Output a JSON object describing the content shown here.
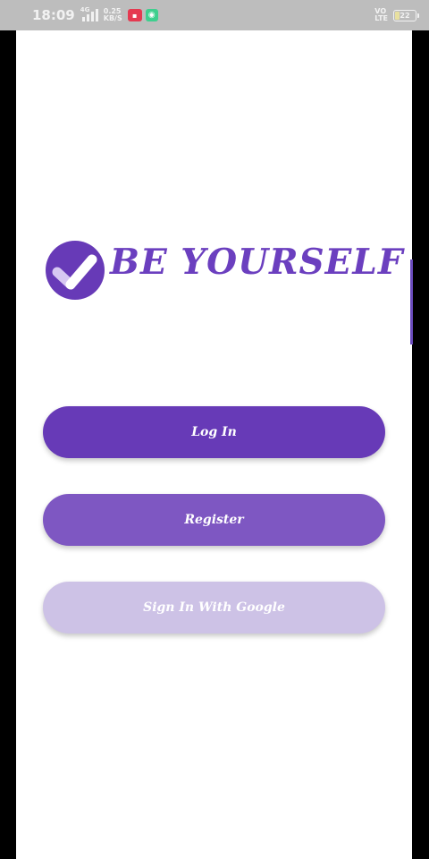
{
  "status_bar": {
    "time": "18:09",
    "network": "4G",
    "speed_value": "0.25",
    "speed_unit": "KB/S",
    "volte_top": "VO",
    "volte_bottom": "LTE",
    "battery_level": "22"
  },
  "brand": {
    "title": "BE YOURSELF",
    "logo_icon": "check-circle-icon",
    "accent_color": "#673ab7"
  },
  "buttons": {
    "login_label": "Log In",
    "register_label": "Register",
    "google_label": "Sign In With Google"
  },
  "colors": {
    "login_bg": "#673ab7",
    "register_bg": "#7e57c2",
    "google_bg": "#cdc2e6"
  }
}
